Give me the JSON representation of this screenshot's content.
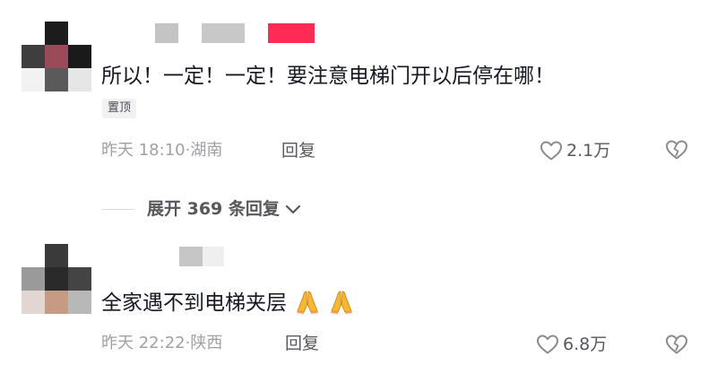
{
  "comments": [
    {
      "text": "所以！一定！一定！要注意电梯门开以后停在哪！",
      "badge": "置顶",
      "timestamp": "昨天 18:10·湖南",
      "reply_label": "回复",
      "likes": "2.1万",
      "expand_replies": "展开 369 条回复",
      "avatar_icon": "pixelated-avatar",
      "username_censored": true,
      "colors": {
        "username_accent": "#fe2c55",
        "blur_gray": "#c8c8c8"
      }
    },
    {
      "text": "全家遇不到电梯夹层",
      "emoji": [
        "folded-hands",
        "folded-hands"
      ],
      "timestamp": "昨天 22:22·陕西",
      "reply_label": "回复",
      "likes": "6.8万",
      "avatar_icon": "pixelated-avatar",
      "username_censored": true
    }
  ],
  "icons": {
    "like": "heart-outline-icon",
    "dislike": "broken-heart-icon",
    "expand": "chevron-down-icon"
  },
  "colors": {
    "text_primary": "#161823",
    "text_secondary": "#a0a0a6",
    "text_action": "#57585e",
    "accent": "#fe2c55"
  }
}
